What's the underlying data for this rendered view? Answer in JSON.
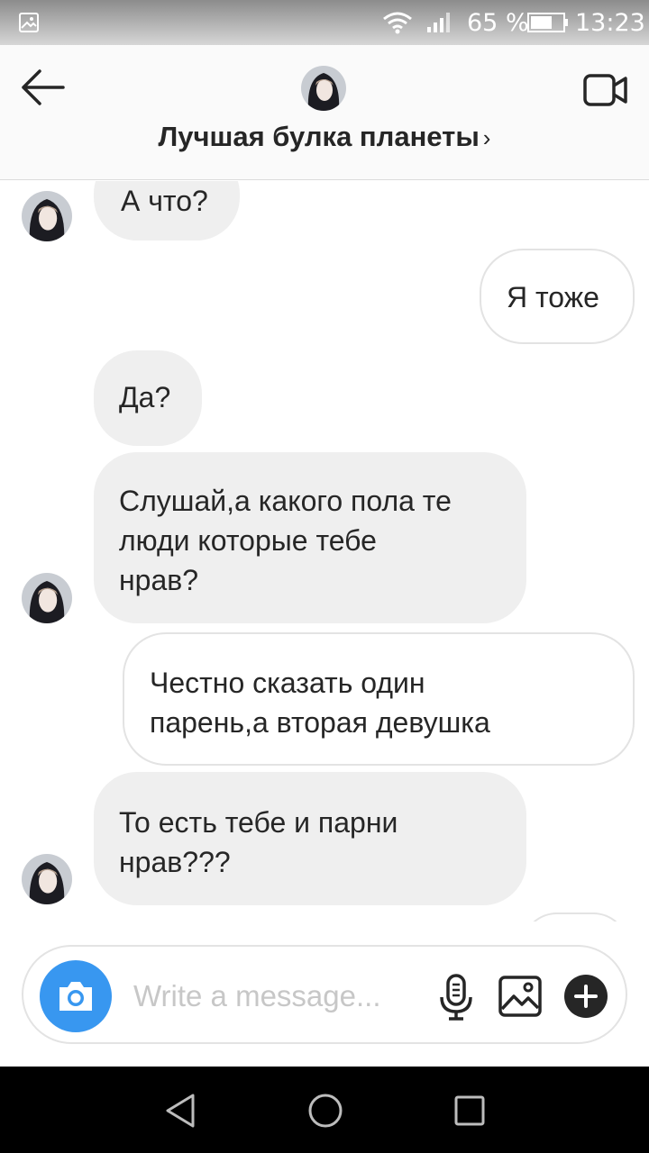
{
  "status_bar": {
    "battery_percent": "65 %",
    "time": "13:23",
    "icons": [
      "image-icon",
      "wifi-icon",
      "signal-icon",
      "battery-icon"
    ]
  },
  "header": {
    "title": "Лучшая булка планеты",
    "chevron": "›",
    "icons": [
      "back-arrow-icon",
      "avatar",
      "video-call-icon"
    ]
  },
  "messages": [
    {
      "from": "them",
      "text": "А что?"
    },
    {
      "from": "me",
      "text": "Я тоже"
    },
    {
      "from": "them",
      "text": "Да?"
    },
    {
      "from": "them",
      "text": "Слушай,а какого пола те\nлюди которые тебе\nнрав?"
    },
    {
      "from": "me",
      "text": "Честно сказать один\nпарень,а вторая девушка"
    },
    {
      "from": "them",
      "text": "То есть тебе и парни\nнрав???"
    }
  ],
  "composer": {
    "placeholder": "Write a message...",
    "icons": [
      "camera-icon",
      "microphone-icon",
      "gallery-icon",
      "plus-icon"
    ]
  },
  "colors": {
    "accent": "#3897f0",
    "incoming_bubble": "#efefef",
    "outgoing_border": "#e3e3e3",
    "nav_bar": "#000000"
  }
}
